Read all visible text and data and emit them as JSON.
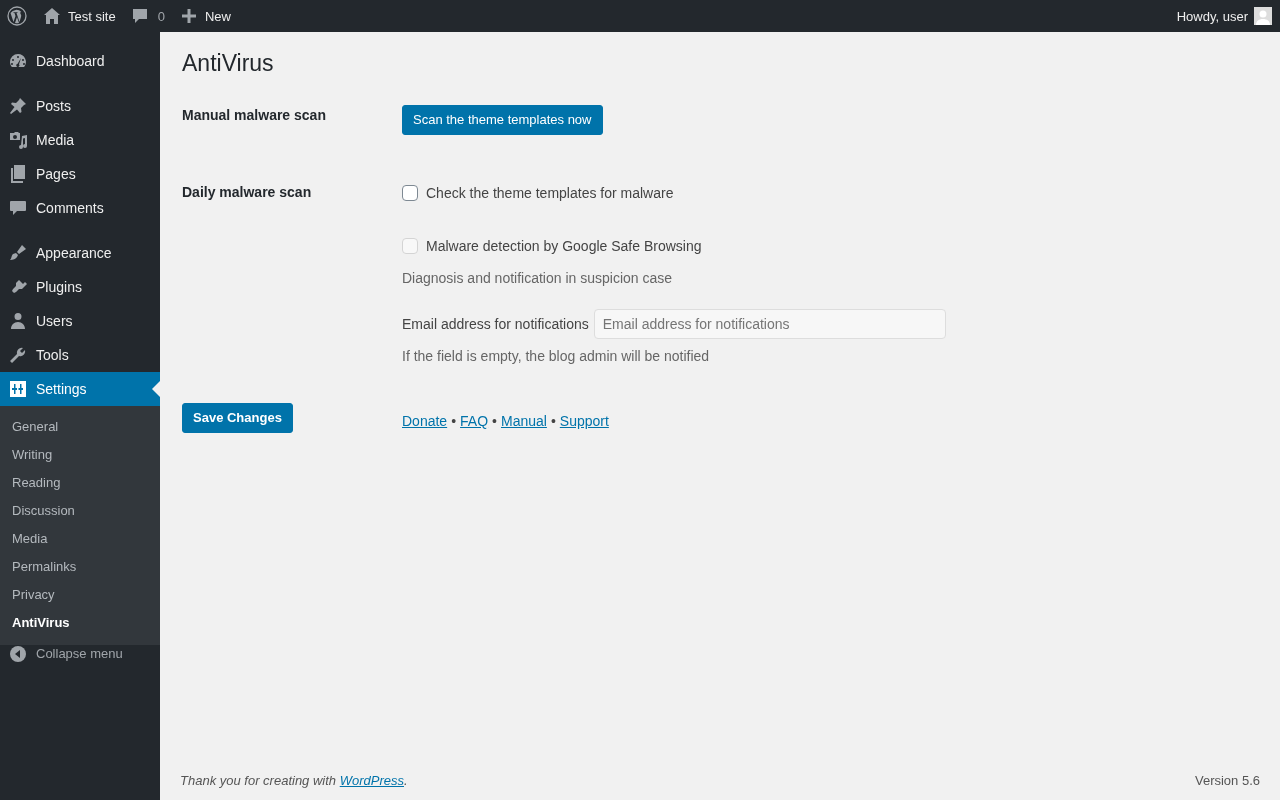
{
  "admin_bar": {
    "site_name": "Test site",
    "comments_count": "0",
    "new_label": "New",
    "greeting": "Howdy, user"
  },
  "sidebar": {
    "groups": [
      [
        {
          "label": "Dashboard",
          "selected": false
        }
      ],
      [
        {
          "label": "Posts",
          "selected": false
        },
        {
          "label": "Media",
          "selected": false
        },
        {
          "label": "Pages",
          "selected": false
        },
        {
          "label": "Comments",
          "selected": false
        }
      ],
      [
        {
          "label": "Appearance",
          "selected": false
        },
        {
          "label": "Plugins",
          "selected": false
        },
        {
          "label": "Users",
          "selected": false
        },
        {
          "label": "Tools",
          "selected": false
        },
        {
          "label": "Settings",
          "selected": true,
          "children": [
            {
              "label": "General",
              "selected": false
            },
            {
              "label": "Writing",
              "selected": false
            },
            {
              "label": "Reading",
              "selected": false
            },
            {
              "label": "Discussion",
              "selected": false
            },
            {
              "label": "Media",
              "selected": false
            },
            {
              "label": "Permalinks",
              "selected": false
            },
            {
              "label": "Privacy",
              "selected": false
            },
            {
              "label": "AntiVirus",
              "selected": true
            }
          ]
        }
      ]
    ],
    "collapse_label": "Collapse menu"
  },
  "page": {
    "title": "AntiVirus",
    "rows": [
      {
        "kind": "button",
        "label": "Manual malware scan",
        "button": "Scan the theme templates now"
      },
      {
        "kind": "options",
        "label": "Daily malware scan",
        "options": [
          {
            "label": "Check the theme templates for malware",
            "checked": false,
            "disabled": false
          },
          {
            "label": "Malware detection by Google Safe Browsing",
            "checked": false,
            "disabled": true
          }
        ],
        "description": "Diagnosis and notification in suspicion case",
        "email": {
          "label": "Email address for notifications",
          "placeholder": "Email address for notifications"
        },
        "note": "If the field is empty, the blog admin will be notified"
      }
    ],
    "save_button": "Save Changes",
    "links": [
      "Donate",
      "FAQ",
      "Manual",
      "Support"
    ],
    "link_separator": "•"
  },
  "footer": {
    "text_before": "Thank you for creating with ",
    "link": "WordPress",
    "text_after": ".",
    "version": "Version 5.6"
  }
}
